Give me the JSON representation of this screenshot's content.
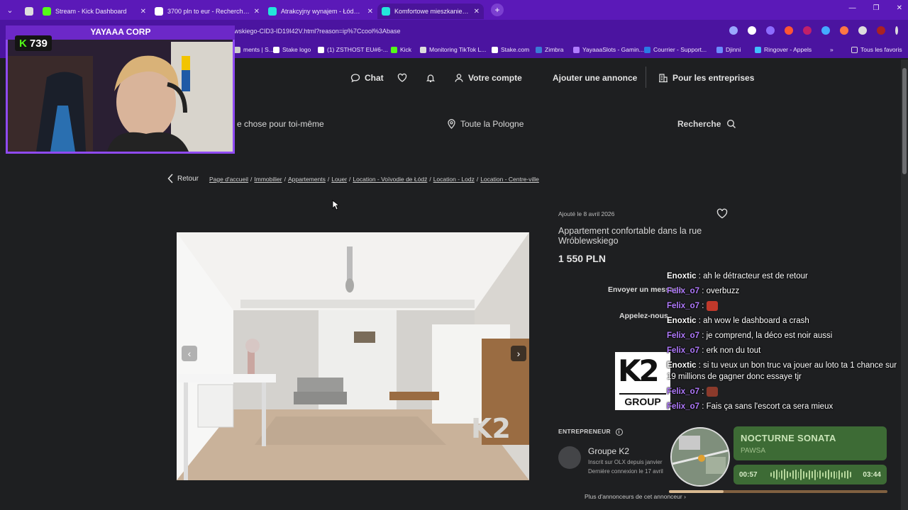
{
  "browser": {
    "tabs": [
      {
        "title": "Stream - Kick Dashboard",
        "favicon_color": "#53fc18",
        "active": false
      },
      {
        "title": "3700 pln to eur - Recherche Go",
        "favicon_color": "#ffffff",
        "active": false
      },
      {
        "title": "Atrakcyjny wynajem - Łódź - sp",
        "favicon_color": "#23e5db",
        "active": false
      },
      {
        "title": "Komfortowe mieszkanie przy ul",
        "favicon_color": "#23e5db",
        "active": true
      }
    ],
    "new_tab_label": "+",
    "url": "wskiego-CID3-ID19I42V.html?reason=ip%7Ccool%3Abase",
    "bookmarks": [
      {
        "label": "ments | S...",
        "color": "#cccccc"
      },
      {
        "label": "Stake logo",
        "color": "#ffffff"
      },
      {
        "label": "(1) ZSTHOST EU#6-...",
        "color": "#ffffff"
      },
      {
        "label": "Kick",
        "color": "#53fc18"
      },
      {
        "label": "Monitoring TikTok L...",
        "color": "#dddddd"
      },
      {
        "label": "Stake.com",
        "color": "#ffffff"
      },
      {
        "label": "Zimbra",
        "color": "#3a7bd5"
      },
      {
        "label": "YayaaaSlots - Gamin...",
        "color": "#b07cff"
      },
      {
        "label": "Courrier - Support...",
        "color": "#2a7be4"
      },
      {
        "label": "Djinni",
        "color": "#6b8cff"
      },
      {
        "label": "Ringover - Appels",
        "color": "#40c0ff"
      }
    ],
    "bookmarks_more": "»",
    "all_favorites": "Tous les favoris"
  },
  "site": {
    "nav": {
      "chat": "Chat",
      "account": "Votre compte",
      "add_listing": "Ajouter une annonce",
      "business": "Pour les entreprises"
    },
    "search": {
      "query_fragment": "e chose pour toi-même",
      "location": "Toute la Pologne",
      "button": "Recherche"
    },
    "back": "Retour",
    "breadcrumb": [
      "Page d'accueil",
      "Immobilier",
      "Appartements",
      "Louer",
      "Location - Voïvodie de Łódź",
      "Location - Lodz",
      "Location - Centre-ville"
    ],
    "listing": {
      "added": "Ajouté le 8 avril 2026",
      "title": "Appartement confortable dans la rue Wróblewskiego",
      "price": "1 550 PLN",
      "send_message": "Envoyer un message",
      "call": "Appelez-nous",
      "entrepreneur_label": "ENTREPRENEUR",
      "seller_name": "Groupe K2",
      "seller_since": "Inscrit sur OLX depuis janvier",
      "last_login": "Dernière connexion le 17 avril",
      "more_from_seller": "Plus d'annonceurs de cet annonceur",
      "logo_mark": "K2",
      "logo_text": "GROUP"
    }
  },
  "stream": {
    "channel": "YAYAAA CORP",
    "viewers": "739",
    "chat": [
      {
        "user": "Enoxtic",
        "style": "u1",
        "text": "ah le détracteur est de retour"
      },
      {
        "user": "Felix_o7",
        "style": "u2",
        "text": "overbuzz"
      },
      {
        "user": "Felix_o7",
        "style": "u2",
        "text": "",
        "emote": "#c0392b"
      },
      {
        "user": "Enoxtic",
        "style": "u1",
        "text": "ah wow le dashboard a crash"
      },
      {
        "user": "Felix_o7",
        "style": "u2",
        "text": "je comprend, la déco est noir aussi"
      },
      {
        "user": "Felix_o7",
        "style": "u2",
        "text": "erk non du tout"
      },
      {
        "user": "Enoxtic",
        "style": "u1",
        "text": "si tu veux un bon truc va jouer au loto ta 1 chance sur 19 millions de gagner donc essaye tjr"
      },
      {
        "user": "Felix_o7",
        "style": "u2",
        "text": "",
        "emote": "#8b3a2b"
      },
      {
        "user": "Felix_o7",
        "style": "u2",
        "text": "Fais ça sans l'escort ca sera mieux"
      }
    ],
    "music": {
      "song": "NOCTURNE SONATA",
      "artist": "PAWSA",
      "elapsed": "00:57",
      "duration": "03:44",
      "progress": 0.25
    }
  }
}
